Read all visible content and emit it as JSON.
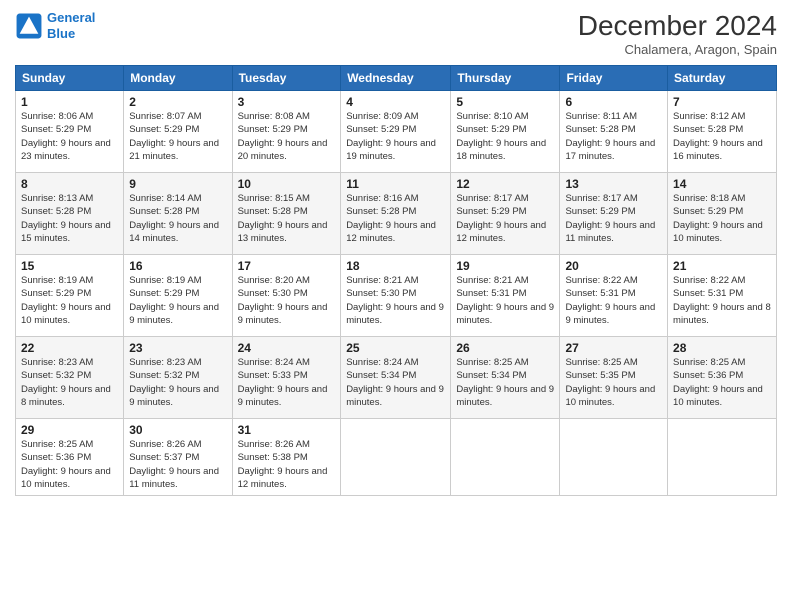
{
  "header": {
    "logo_line1": "General",
    "logo_line2": "Blue",
    "month_title": "December 2024",
    "location": "Chalamera, Aragon, Spain"
  },
  "days_of_week": [
    "Sunday",
    "Monday",
    "Tuesday",
    "Wednesday",
    "Thursday",
    "Friday",
    "Saturday"
  ],
  "weeks": [
    [
      {
        "num": "1",
        "sunrise": "8:06 AM",
        "sunset": "5:29 PM",
        "daylight": "9 hours and 23 minutes."
      },
      {
        "num": "2",
        "sunrise": "8:07 AM",
        "sunset": "5:29 PM",
        "daylight": "9 hours and 21 minutes."
      },
      {
        "num": "3",
        "sunrise": "8:08 AM",
        "sunset": "5:29 PM",
        "daylight": "9 hours and 20 minutes."
      },
      {
        "num": "4",
        "sunrise": "8:09 AM",
        "sunset": "5:29 PM",
        "daylight": "9 hours and 19 minutes."
      },
      {
        "num": "5",
        "sunrise": "8:10 AM",
        "sunset": "5:29 PM",
        "daylight": "9 hours and 18 minutes."
      },
      {
        "num": "6",
        "sunrise": "8:11 AM",
        "sunset": "5:28 PM",
        "daylight": "9 hours and 17 minutes."
      },
      {
        "num": "7",
        "sunrise": "8:12 AM",
        "sunset": "5:28 PM",
        "daylight": "9 hours and 16 minutes."
      }
    ],
    [
      {
        "num": "8",
        "sunrise": "8:13 AM",
        "sunset": "5:28 PM",
        "daylight": "9 hours and 15 minutes."
      },
      {
        "num": "9",
        "sunrise": "8:14 AM",
        "sunset": "5:28 PM",
        "daylight": "9 hours and 14 minutes."
      },
      {
        "num": "10",
        "sunrise": "8:15 AM",
        "sunset": "5:28 PM",
        "daylight": "9 hours and 13 minutes."
      },
      {
        "num": "11",
        "sunrise": "8:16 AM",
        "sunset": "5:28 PM",
        "daylight": "9 hours and 12 minutes."
      },
      {
        "num": "12",
        "sunrise": "8:17 AM",
        "sunset": "5:29 PM",
        "daylight": "9 hours and 12 minutes."
      },
      {
        "num": "13",
        "sunrise": "8:17 AM",
        "sunset": "5:29 PM",
        "daylight": "9 hours and 11 minutes."
      },
      {
        "num": "14",
        "sunrise": "8:18 AM",
        "sunset": "5:29 PM",
        "daylight": "9 hours and 10 minutes."
      }
    ],
    [
      {
        "num": "15",
        "sunrise": "8:19 AM",
        "sunset": "5:29 PM",
        "daylight": "9 hours and 10 minutes."
      },
      {
        "num": "16",
        "sunrise": "8:19 AM",
        "sunset": "5:29 PM",
        "daylight": "9 hours and 9 minutes."
      },
      {
        "num": "17",
        "sunrise": "8:20 AM",
        "sunset": "5:30 PM",
        "daylight": "9 hours and 9 minutes."
      },
      {
        "num": "18",
        "sunrise": "8:21 AM",
        "sunset": "5:30 PM",
        "daylight": "9 hours and 9 minutes."
      },
      {
        "num": "19",
        "sunrise": "8:21 AM",
        "sunset": "5:31 PM",
        "daylight": "9 hours and 9 minutes."
      },
      {
        "num": "20",
        "sunrise": "8:22 AM",
        "sunset": "5:31 PM",
        "daylight": "9 hours and 9 minutes."
      },
      {
        "num": "21",
        "sunrise": "8:22 AM",
        "sunset": "5:31 PM",
        "daylight": "9 hours and 8 minutes."
      }
    ],
    [
      {
        "num": "22",
        "sunrise": "8:23 AM",
        "sunset": "5:32 PM",
        "daylight": "9 hours and 8 minutes."
      },
      {
        "num": "23",
        "sunrise": "8:23 AM",
        "sunset": "5:32 PM",
        "daylight": "9 hours and 9 minutes."
      },
      {
        "num": "24",
        "sunrise": "8:24 AM",
        "sunset": "5:33 PM",
        "daylight": "9 hours and 9 minutes."
      },
      {
        "num": "25",
        "sunrise": "8:24 AM",
        "sunset": "5:34 PM",
        "daylight": "9 hours and 9 minutes."
      },
      {
        "num": "26",
        "sunrise": "8:25 AM",
        "sunset": "5:34 PM",
        "daylight": "9 hours and 9 minutes."
      },
      {
        "num": "27",
        "sunrise": "8:25 AM",
        "sunset": "5:35 PM",
        "daylight": "9 hours and 10 minutes."
      },
      {
        "num": "28",
        "sunrise": "8:25 AM",
        "sunset": "5:36 PM",
        "daylight": "9 hours and 10 minutes."
      }
    ],
    [
      {
        "num": "29",
        "sunrise": "8:25 AM",
        "sunset": "5:36 PM",
        "daylight": "9 hours and 10 minutes."
      },
      {
        "num": "30",
        "sunrise": "8:26 AM",
        "sunset": "5:37 PM",
        "daylight": "9 hours and 11 minutes."
      },
      {
        "num": "31",
        "sunrise": "8:26 AM",
        "sunset": "5:38 PM",
        "daylight": "9 hours and 12 minutes."
      },
      null,
      null,
      null,
      null
    ]
  ]
}
